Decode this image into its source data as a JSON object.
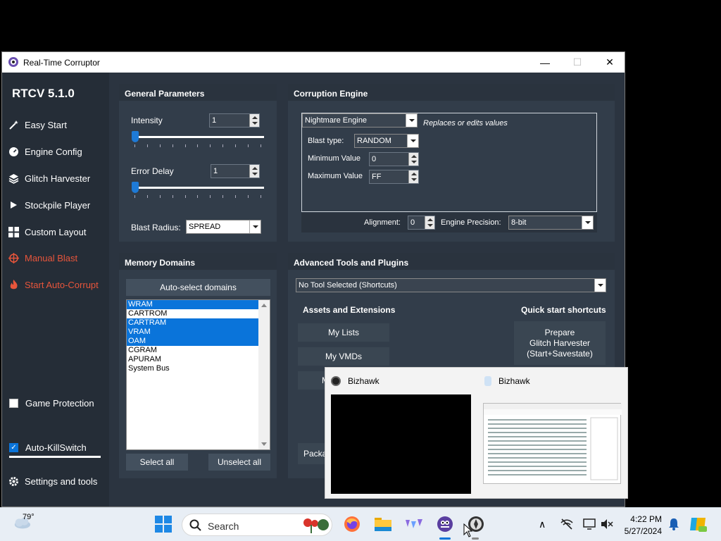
{
  "window": {
    "title": "Real-Time Corruptor",
    "minimize": "—",
    "maximize": "☐",
    "close": "✕"
  },
  "sidebar": {
    "version": "RTCV 5.1.0",
    "items": [
      {
        "label": "Easy Start",
        "icon": "wand-icon"
      },
      {
        "label": "Engine Config",
        "icon": "gauge-icon"
      },
      {
        "label": "Glitch Harvester",
        "icon": "layers-icon"
      },
      {
        "label": "Stockpile Player",
        "icon": "play-icon"
      },
      {
        "label": "Custom Layout",
        "icon": "grid-icon"
      },
      {
        "label": "Manual Blast",
        "icon": "crosshair-icon"
      },
      {
        "label": "Start Auto-Corrupt",
        "icon": "flame-icon"
      }
    ],
    "game_protection": "Game Protection",
    "auto_killswitch": "Auto-KillSwitch",
    "settings": "Settings and tools"
  },
  "general": {
    "title": "General Parameters",
    "intensity_label": "Intensity",
    "intensity_value": "1",
    "error_delay_label": "Error Delay",
    "error_delay_value": "1",
    "blast_radius_label": "Blast Radius:",
    "blast_radius_value": "SPREAD"
  },
  "engine": {
    "title": "Corruption Engine",
    "engine_select": "Nightmare Engine",
    "description": "Replaces or edits values",
    "blast_type_label": "Blast type:",
    "blast_type_value": "RANDOM",
    "min_label": "Minimum Value",
    "min_value": "0",
    "max_label": "Maximum Value",
    "max_value": "FF",
    "alignment_label": "Alignment:",
    "alignment_value": "0",
    "precision_label": "Engine Precision:",
    "precision_value": "8-bit"
  },
  "memory": {
    "title": "Memory Domains",
    "auto_select": "Auto-select domains",
    "domains": [
      "WRAM",
      "CARTROM",
      "CARTRAM",
      "VRAM",
      "OAM",
      "CGRAM",
      "APURAM",
      "System Bus"
    ],
    "select_all": "Select all",
    "unselect_all": "Unselect all"
  },
  "advanced": {
    "title": "Advanced Tools and Plugins",
    "tool_select": "No Tool Selected (Shortcuts)",
    "assets_label": "Assets and Extensions",
    "quick_label": "Quick start shortcuts",
    "my_lists": "My Lists",
    "my_vmds": "My VMDs",
    "partial_m": "M",
    "partial_packa": "Packa",
    "prepare_line1": "Prepare",
    "prepare_line2": "Glitch Harvester",
    "prepare_line3": "(Start+Savestate)"
  },
  "preview": {
    "window1_title": "Bizhawk",
    "window2_title": "Bizhawk"
  },
  "taskbar": {
    "weather_temp": "79°",
    "search_placeholder": "Search",
    "time": "4:22 PM",
    "date": "5/27/2024"
  },
  "colors": {
    "accent": "#0a74da",
    "warning": "#e8553b",
    "panel": "#323d4a"
  }
}
